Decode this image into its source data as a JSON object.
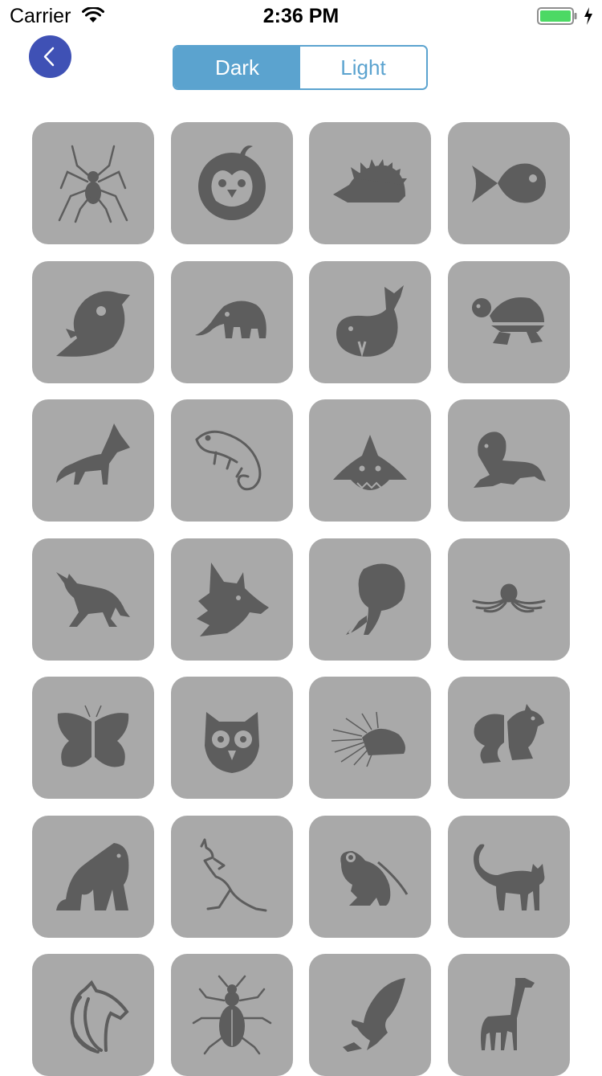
{
  "status_bar": {
    "carrier": "Carrier",
    "time": "2:36 PM"
  },
  "nav": {
    "back_label": "Back"
  },
  "theme_segment": {
    "options": [
      "Dark",
      "Light"
    ],
    "selected": "Dark"
  },
  "colors": {
    "accent": "#5ba3cf",
    "back_button": "#3f51b5",
    "tile_bg": "#a9a9a9",
    "icon": "#5d5d5d",
    "battery": "#4cd964"
  },
  "animals": [
    "spider",
    "penguin",
    "hedgehog",
    "fish",
    "bird",
    "elephant",
    "whale",
    "turtle",
    "fox",
    "chameleon",
    "shark",
    "lion",
    "wolf",
    "wolf-head",
    "elephant-head",
    "octopus",
    "butterfly",
    "owl",
    "porcupine",
    "squirrel",
    "gorilla",
    "kangaroo",
    "frog",
    "cat",
    "horse",
    "beetle",
    "eagle",
    "giraffe"
  ]
}
